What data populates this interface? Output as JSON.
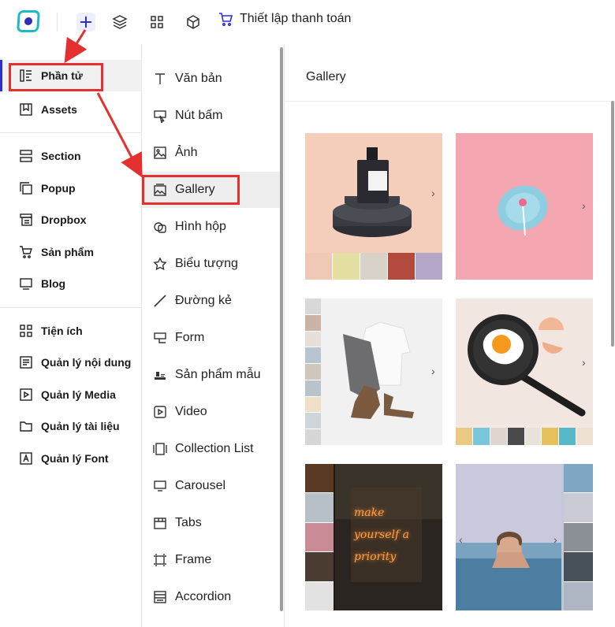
{
  "topbar": {
    "checkout_label": "Thiết lập thanh toán",
    "icons": [
      "logo-icon",
      "plus-icon",
      "layers-icon",
      "grid-icon",
      "box-icon",
      "cart-icon"
    ]
  },
  "sidebar": {
    "items": [
      {
        "label": "Phần tử",
        "icon": "elements-icon"
      },
      {
        "label": "Assets",
        "icon": "bookmark-icon"
      },
      {
        "label": "Section",
        "icon": "section-icon"
      },
      {
        "label": "Popup",
        "icon": "popup-icon"
      },
      {
        "label": "Dropbox",
        "icon": "dropbox-icon"
      },
      {
        "label": "Sản phẩm",
        "icon": "cart-icon"
      },
      {
        "label": "Blog",
        "icon": "blog-icon"
      },
      {
        "label": "Tiện ích",
        "icon": "apps-icon"
      },
      {
        "label": "Quản lý nội dung",
        "icon": "content-icon"
      },
      {
        "label": "Quản lý Media",
        "icon": "media-icon"
      },
      {
        "label": "Quản lý tài liệu",
        "icon": "folder-icon"
      },
      {
        "label": "Quản lý Font",
        "icon": "font-icon"
      }
    ]
  },
  "elements": {
    "items": [
      {
        "label": "Văn bản",
        "icon": "text-icon"
      },
      {
        "label": "Nút bấm",
        "icon": "button-icon"
      },
      {
        "label": "Ảnh",
        "icon": "image-icon"
      },
      {
        "label": "Gallery",
        "icon": "gallery-icon"
      },
      {
        "label": "Hình hộp",
        "icon": "box-shape-icon"
      },
      {
        "label": "Biểu tượng",
        "icon": "star-icon"
      },
      {
        "label": "Đường kẻ",
        "icon": "line-icon"
      },
      {
        "label": "Form",
        "icon": "form-icon"
      },
      {
        "label": "Sản phẩm mẫu",
        "icon": "product-sample-icon"
      },
      {
        "label": "Video",
        "icon": "video-icon"
      },
      {
        "label": "Collection List",
        "icon": "collection-icon"
      },
      {
        "label": "Carousel",
        "icon": "carousel-icon"
      },
      {
        "label": "Tabs",
        "icon": "tabs-icon"
      },
      {
        "label": "Frame",
        "icon": "frame-icon"
      },
      {
        "label": "Accordion",
        "icon": "accordion-icon"
      }
    ]
  },
  "panel": {
    "title": "Gallery",
    "cards": [
      {
        "name": "gallery-template-perfume",
        "layout": "thumbs-bottom"
      },
      {
        "name": "gallery-template-pink-plate",
        "layout": "single"
      },
      {
        "name": "gallery-template-clothes",
        "layout": "thumbs-left"
      },
      {
        "name": "gallery-template-egg-pan",
        "layout": "thumbs-bottom"
      },
      {
        "name": "gallery-template-neon",
        "layout": "thumbs-left"
      },
      {
        "name": "gallery-template-sea-woman",
        "layout": "thumbs-right"
      }
    ],
    "neon_text": "make yourself a priority"
  },
  "colors": {
    "accent": "#2b2fd6",
    "annotation_red": "#e53030",
    "active_bg": "#eeeeee"
  }
}
